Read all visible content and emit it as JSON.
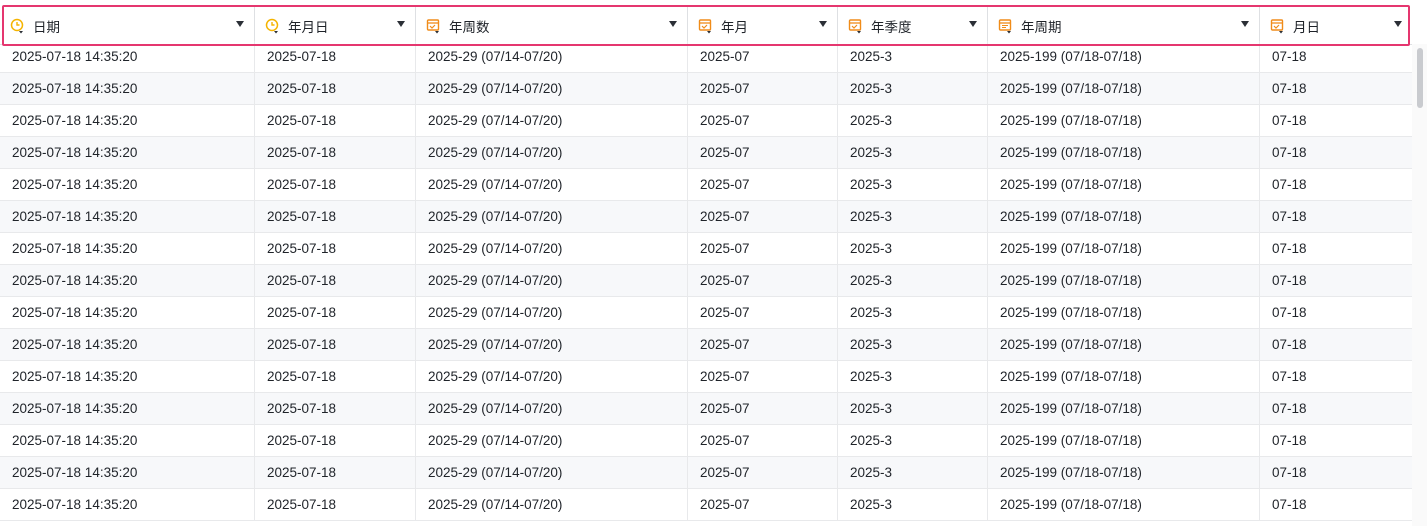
{
  "table": {
    "columns": [
      {
        "label": "日期",
        "icon": "clock-icon"
      },
      {
        "label": "年月日",
        "icon": "clock-icon"
      },
      {
        "label": "年周数",
        "icon": "calendar-icon"
      },
      {
        "label": "年月",
        "icon": "calendar-icon"
      },
      {
        "label": "年季度",
        "icon": "calendar-icon"
      },
      {
        "label": "年周期",
        "icon": "calendar-week-icon"
      },
      {
        "label": "月日",
        "icon": "calendar-icon"
      }
    ],
    "row_values": [
      "2025-07-18 14:35:20",
      "2025-07-18",
      "2025-29 (07/14-07/20)",
      "2025-07",
      "2025-3",
      "2025-199 (07/18-07/18)",
      "07-18"
    ],
    "row_count": 15
  },
  "colors": {
    "clock_icon": "#f5b400",
    "calendar_icon": "#f08c1a",
    "highlight_border": "#e5366f"
  }
}
